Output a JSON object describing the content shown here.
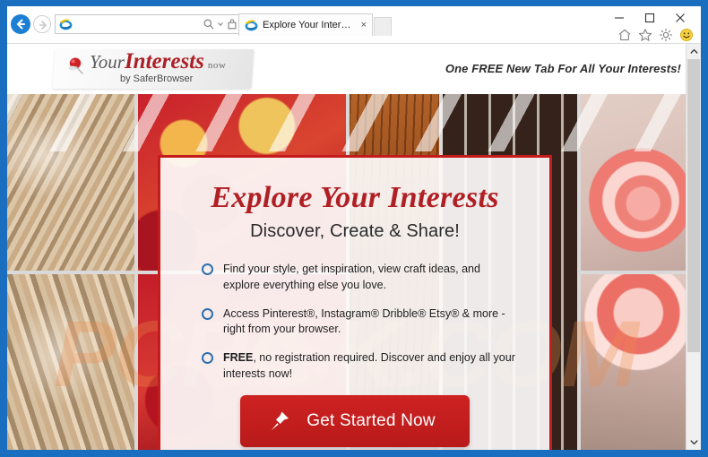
{
  "browser": {
    "back_icon": "back-arrow-icon",
    "forward_icon": "forward-arrow-icon",
    "address_value": "",
    "address_placeholder": "",
    "search_icon": "search-magnifier-icon",
    "dropdown_icon": "chevron-down-icon",
    "go_icon": "go-icon",
    "refresh_icon": "refresh-icon",
    "favicon": "internet-explorer-icon",
    "tab": {
      "label": "Explore Your Interests, All for...",
      "close_label": "×"
    },
    "new_tab_label": "",
    "window_controls": {
      "minimize": "—",
      "maximize": "□",
      "close": "✕"
    },
    "tool_icons": [
      {
        "name": "home-icon"
      },
      {
        "name": "favorites-star-icon"
      },
      {
        "name": "settings-gear-icon"
      },
      {
        "name": "feedback-smiley-icon"
      }
    ]
  },
  "page_header": {
    "logo": {
      "word_your": "Your",
      "word_interests": "Interests",
      "word_now": "now",
      "byline": "by  SaferBrowser",
      "pin_icon": "red-pushpin-icon"
    },
    "tagline": "One FREE New Tab For All Your Interests!"
  },
  "collage": {
    "tiles": [
      {
        "name": "photo-braided-hair-top",
        "style": "ph-hair1"
      },
      {
        "name": "photo-braided-hair-bottom",
        "style": "ph-hair2"
      },
      {
        "name": "photo-berries-top",
        "style": "ph-berry1"
      },
      {
        "name": "photo-berries-bottom",
        "style": "ph-berry2"
      },
      {
        "name": "photo-wood-texture",
        "style": "ph-wood"
      },
      {
        "name": "photo-dark-panel",
        "style": "ph-dark"
      },
      {
        "name": "photo-guitar-fretboard",
        "style": "ph-guitar"
      },
      {
        "name": "photo-pink-rose-top",
        "style": "ph-rose1"
      },
      {
        "name": "photo-pink-rose-bottom",
        "style": "ph-rose2"
      }
    ]
  },
  "watermark": {
    "text": "PCRISK.COM"
  },
  "promo": {
    "heading": "Explore Your Interests",
    "subheading": "Discover, Create & Share!",
    "bullets": [
      {
        "bold": "",
        "text": "Find your style, get inspiration, view craft ideas, and explore everything else you love."
      },
      {
        "bold": "",
        "text": "Access Pinterest®, Instagram® Dribble® Etsy® & more - right from your browser."
      },
      {
        "bold": "FREE",
        "text": ", no registration required. Discover and enjoy all your interests now!"
      }
    ],
    "cta_label": "Get Started Now",
    "cta_icon": "white-pushpin-icon"
  },
  "scrollbar": {
    "up_icon": "chevron-up-icon",
    "down_icon": "chevron-down-icon"
  },
  "colors": {
    "window_frame": "#1a6ec0",
    "brand_red": "#b01f24",
    "card_border": "#c41c1c",
    "cta_red": "#ce2222",
    "bullet_blue": "#2f6fae",
    "watermark_orange": "#ec8c48"
  }
}
